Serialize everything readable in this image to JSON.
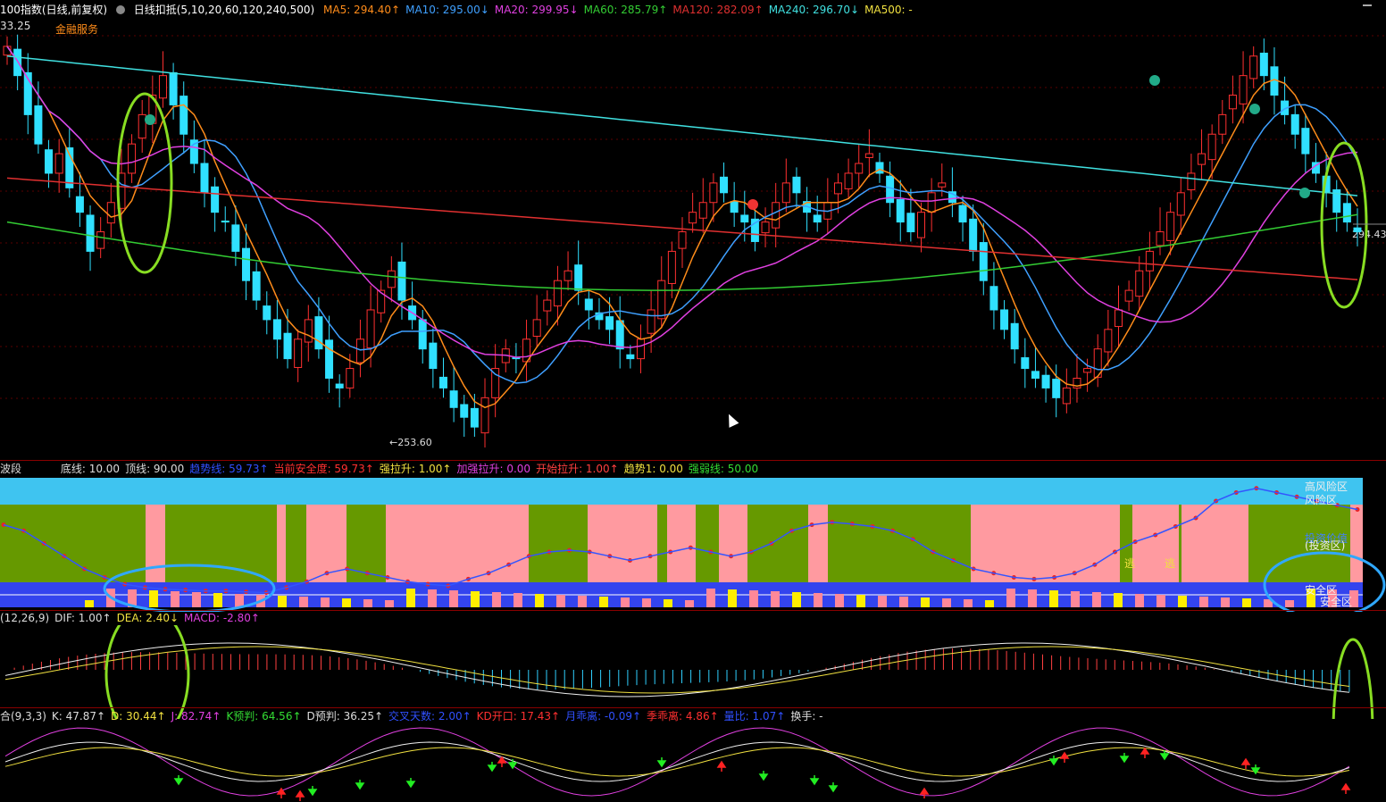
{
  "main_header": {
    "title": "100指数(日线,前复权)",
    "indicator_name": "日线扣抵(5,10,20,60,120,240,500)",
    "ma": [
      {
        "label": "MA5: 294.40↑",
        "color": "#ff8c1a"
      },
      {
        "label": "MA10: 295.00↓",
        "color": "#3fa0ff"
      },
      {
        "label": "MA20: 299.95↓",
        "color": "#e040e0"
      },
      {
        "label": "MA60: 285.79↑",
        "color": "#33cc33"
      },
      {
        "label": "MA120: 282.09↑",
        "color": "#e03030"
      },
      {
        "label": "MA240: 296.70↓",
        "color": "#40e0e0"
      },
      {
        "label": "MA500: -",
        "color": "#f0e040"
      }
    ],
    "top_price": "33.25",
    "sector": "金融服务",
    "low_label": "←253.60",
    "last_price": "294.43"
  },
  "sub1_header": {
    "name": "波段",
    "items": [
      {
        "label": "底线: 10.00",
        "color": "#dddddd"
      },
      {
        "label": "顶线: 90.00",
        "color": "#dddddd"
      },
      {
        "label": "趋势线: 59.73↑",
        "color": "#3050ff"
      },
      {
        "label": "当前安全度: 59.73↑",
        "color": "#ff3030"
      },
      {
        "label": "强拉升: 1.00↑",
        "color": "#f0e040"
      },
      {
        "label": "加强拉升: 0.00",
        "color": "#e040e0"
      },
      {
        "label": "开始拉升: 1.00↑",
        "color": "#ff4040"
      },
      {
        "label": "趋势1: 0.00",
        "color": "#f0e040"
      },
      {
        "label": "强弱线: 50.00",
        "color": "#33dd33"
      }
    ],
    "zones": {
      "high": "高风险区",
      "risk": "风险区",
      "value": "投资价值",
      "invest": "(投资区)",
      "safe": "安全区",
      "safe2": "安全区"
    },
    "escape": "逃"
  },
  "sub2_header": {
    "items": [
      {
        "label": "(12,26,9)",
        "color": "#dddddd"
      },
      {
        "label": "DIF: 1.00↑",
        "color": "#dddddd"
      },
      {
        "label": "DEA: 2.40↓",
        "color": "#f0e040"
      },
      {
        "label": "MACD: -2.80↑",
        "color": "#e040e0"
      }
    ]
  },
  "sub3_header": {
    "items": [
      {
        "label": "合(9,3,3)",
        "color": "#dddddd"
      },
      {
        "label": "K: 47.87↑",
        "color": "#dddddd"
      },
      {
        "label": "D: 30.44↑",
        "color": "#f0e040"
      },
      {
        "label": "J: 82.74↑",
        "color": "#e040e0"
      },
      {
        "label": "K预判: 64.56↑",
        "color": "#33dd33"
      },
      {
        "label": "D预判: 36.25↑",
        "color": "#dddddd"
      },
      {
        "label": "交叉天数: 2.00↑",
        "color": "#3050ff"
      },
      {
        "label": "KD开口: 17.43↑",
        "color": "#ff3030"
      },
      {
        "label": "月乖离: -0.09↑",
        "color": "#3050ff"
      },
      {
        "label": "季乖离: 4.86↑",
        "color": "#ff3030"
      },
      {
        "label": "量比: 1.07↑",
        "color": "#3050ff"
      },
      {
        "label": "换手: -",
        "color": "#dddddd"
      }
    ]
  },
  "chart_data": {
    "type": "candlestick",
    "close_series": [
      {
        "name": "close",
        "values": [
          332,
          326,
          318,
          312,
          306,
          310,
          303,
          298,
          290,
          294,
          300,
          306,
          312,
          318,
          322,
          326,
          320,
          314,
          308,
          302,
          298,
          296,
          290,
          284,
          280,
          276,
          272,
          268,
          272,
          276,
          270,
          264,
          262,
          266,
          272,
          278,
          282,
          286,
          280,
          276,
          270,
          266,
          262,
          258,
          256,
          254,
          260,
          266,
          270,
          268,
          272,
          276,
          280,
          284,
          286,
          282,
          278,
          276,
          274,
          270,
          268,
          272,
          278,
          284,
          290,
          294,
          298,
          300,
          304,
          302,
          298,
          296,
          292,
          296,
          300,
          304,
          302,
          298,
          296,
          300,
          304,
          306,
          308,
          310,
          306,
          300,
          296,
          294,
          298,
          302,
          304,
          300,
          296,
          290,
          284,
          278,
          274,
          270,
          266,
          264,
          262,
          260,
          262,
          264,
          266,
          270,
          274,
          278,
          282,
          286,
          290,
          294,
          298,
          302,
          306,
          310,
          314,
          318,
          322,
          326,
          330,
          326,
          322,
          318,
          314,
          310,
          306,
          302,
          298,
          296,
          294
        ]
      }
    ],
    "ma_lines": [
      {
        "name": "MA5",
        "color": "#ff8c1a"
      },
      {
        "name": "MA10",
        "color": "#3fa0ff"
      },
      {
        "name": "MA20",
        "color": "#e040e0"
      },
      {
        "name": "MA60",
        "color": "#33cc33"
      },
      {
        "name": "MA120",
        "color": "#e03030"
      },
      {
        "name": "MA240",
        "color": "#40e0e0"
      }
    ],
    "ylim": [
      250,
      336
    ]
  }
}
